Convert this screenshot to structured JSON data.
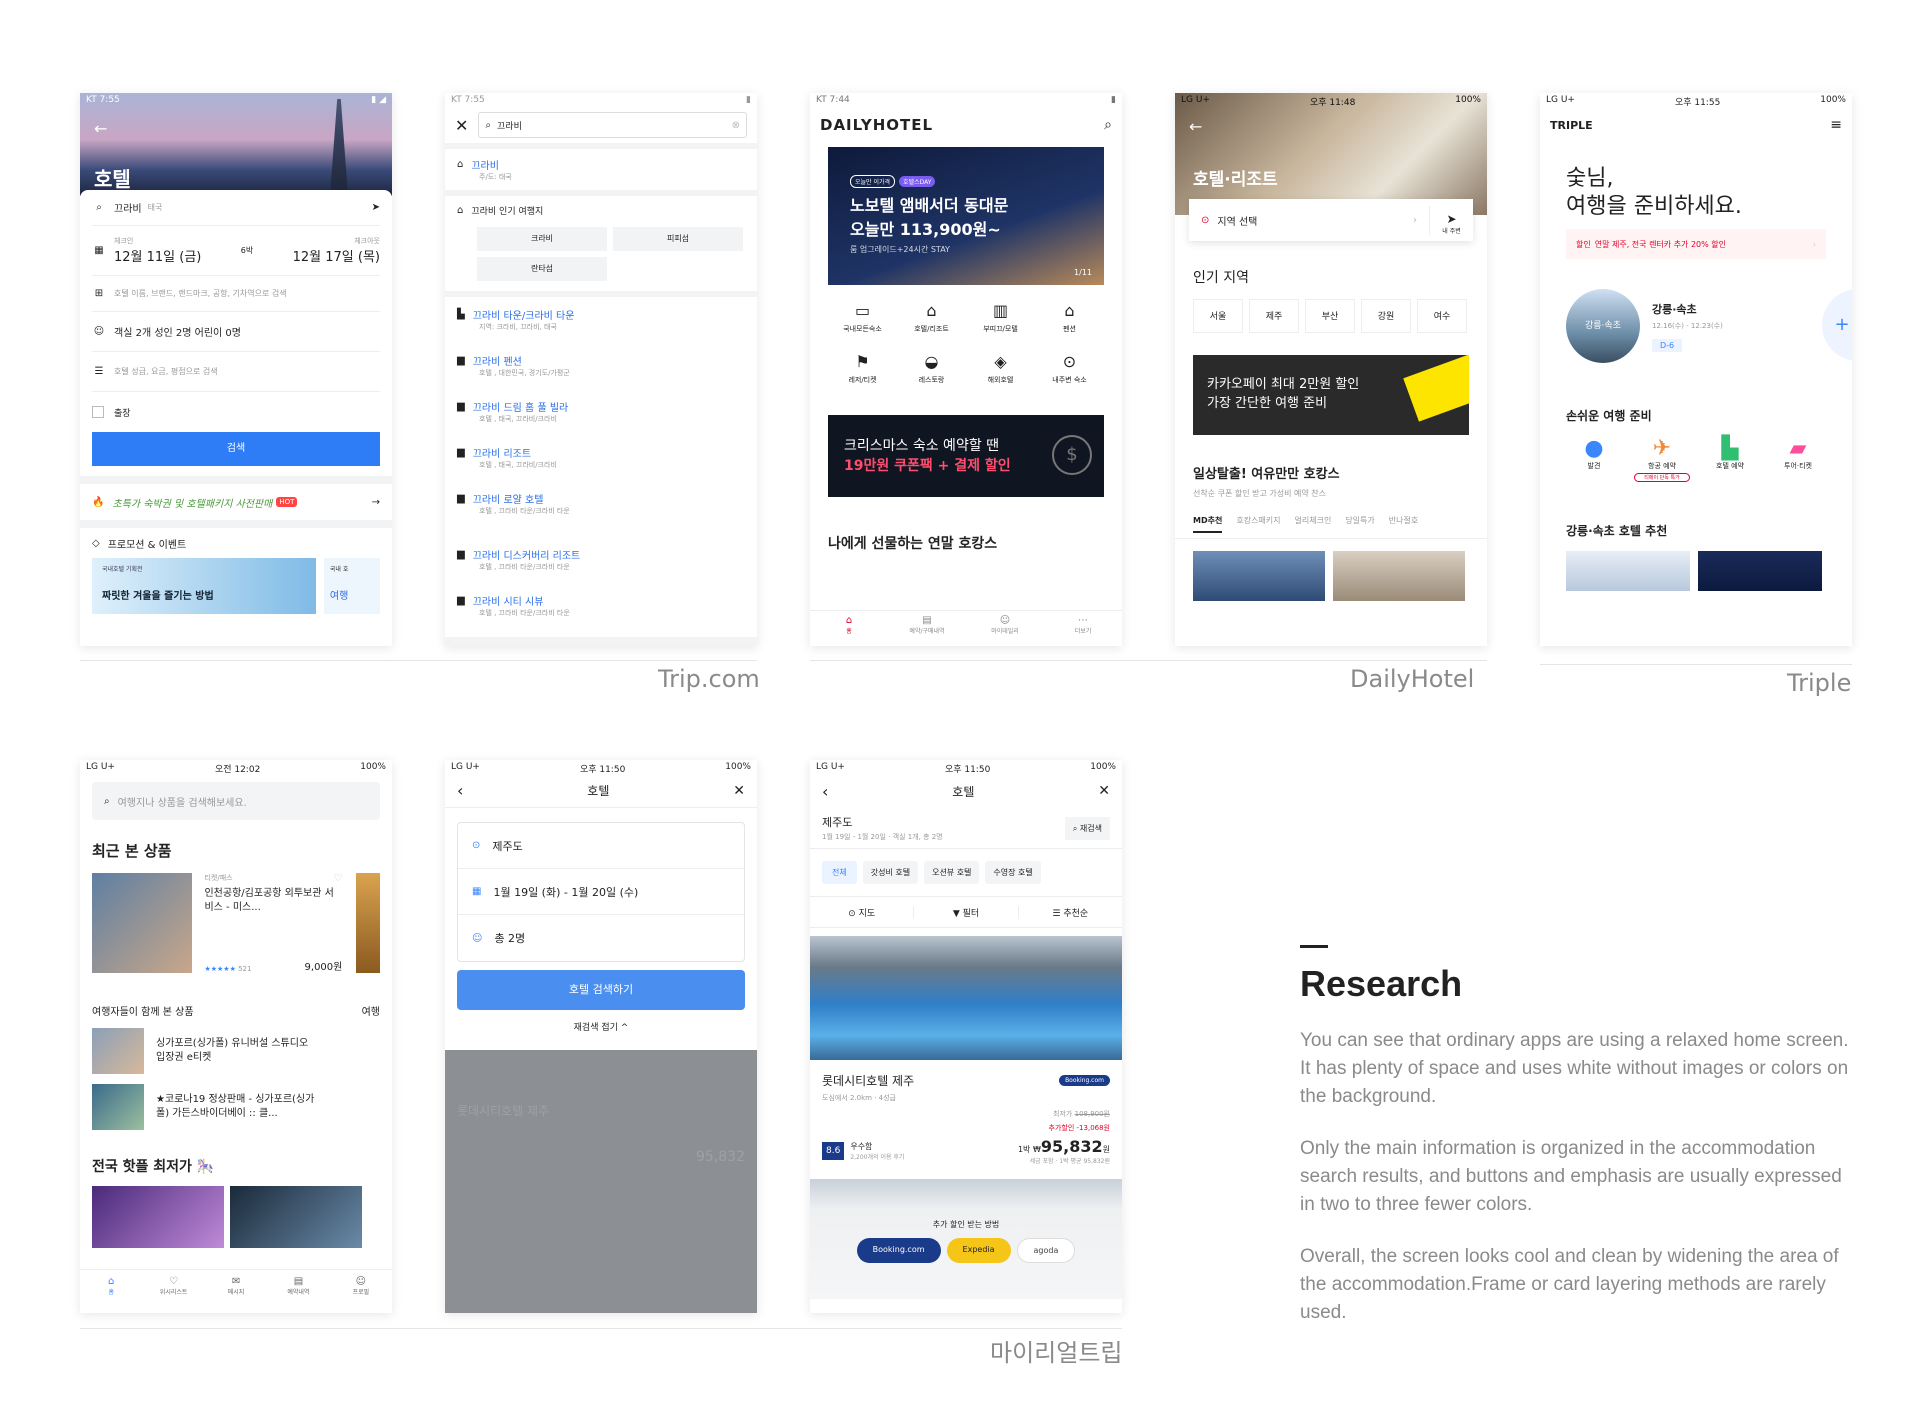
{
  "labels": {
    "trip": "Trip.com",
    "daily": "DailyHotel",
    "triple": "Triple",
    "myreal": "마이리얼트립"
  },
  "trip": {
    "status": "KT 7:55",
    "title": "호텔",
    "search_value": "끄라비",
    "search_tag": "태국",
    "checkin_label": "체크인",
    "checkout_label": "체크아웃",
    "checkin": "12월 11일 (금)",
    "nights": "6박",
    "checkout": "12월 17일 (목)",
    "keyword_placeholder": "호텔 이름, 브랜드, 랜드마크, 공항, 기차역으로 검색",
    "guests": "객실 2개  성인 2명  어린이 0명",
    "filter_placeholder": "호텔 성급, 요금, 평점으로 검색",
    "business": "출장",
    "search_btn": "검색",
    "promo": "초특가 숙박권 및 호텔패키지 사전판매",
    "hot": "HOT",
    "promo_section": "프로모션 & 이벤트",
    "banner_small": "국내호텔 기획전",
    "banner": "짜릿한 겨울을 즐기는 방법",
    "banner2_small": "국내 호",
    "banner2": "여행"
  },
  "trip2": {
    "status": "KT 7:55",
    "query": "끄라비",
    "top_title": "끄라비",
    "top_sub": "주/도: 태국",
    "popular": "끄라비 인기 여행지",
    "chips": [
      "크라비",
      "피피섬",
      "란타섬"
    ],
    "items": [
      {
        "t": "끄라비 타운/크라비 타운",
        "s": "지역: 크라비, 끄라비, 태국"
      },
      {
        "t": "끄라비 펜션",
        "s": "호텔 , 대한민국, 경기도/가평군"
      },
      {
        "t": "끄라비 드림 홈 풀 빌라",
        "s": "호텔 , 태국, 끄라비/크라비"
      },
      {
        "t": "끄라비 리조트",
        "s": "호텔 , 태국, 끄라비/크라비"
      },
      {
        "t": "끄라비 로얄 호텔",
        "s": "호텔 , 끄라비 타운/크라비 타운"
      },
      {
        "t": "끄라비 디스커버리 리조트",
        "s": "호텔 , 끄라비 타운/크라비 타운"
      },
      {
        "t": "끄라비 시티 시뷰",
        "s": "호텔 , 끄라비 타운/크라비 타운"
      }
    ]
  },
  "daily": {
    "status": "KT 7:44",
    "logo": "DAILYHOTEL",
    "tag1": "오늘만 이가격",
    "tag2": "호텔스DAY",
    "hero1": "노보텔 앰배서더 동대문",
    "hero2": "오늘만 113,900원~",
    "hero_sub": "룸 업그레이드+24시간 STAY",
    "pager": "1/11",
    "cats": [
      "국내모든숙소",
      "호텔/리조트",
      "부띠끄/모텔",
      "펜션",
      "레저/티켓",
      "레스토랑",
      "해외호텔",
      "내주변 숙소"
    ],
    "banner1": "크리스마스 숙소 예약할 땐",
    "banner2": "19만원 쿠폰팩 + 결제 할인",
    "section": "나에게 선물하는 연말 호캉스",
    "tabs": [
      "홈",
      "예약/구매내역",
      "마이데일리",
      "더보기"
    ]
  },
  "daily2": {
    "status": "LG U+",
    "time": "오후 11:48",
    "battery": "100%",
    "title": "호텔·리조트",
    "region": "지역 선택",
    "near": "내 주변",
    "popular": "인기 지역",
    "areas": [
      "서울",
      "제주",
      "부산",
      "강원",
      "여수"
    ],
    "kakao1": "카카오페이 최대 2만원 할인",
    "kakao2": "가장 간단한 여행 준비",
    "sec2": "일상탈출! 여유만만 호캉스",
    "sec2_sub": "선착순 쿠폰 할인 받고 가성비 예약 찬스",
    "tabs": [
      "MD추천",
      "호캉스패키지",
      "얼리체크인",
      "당일특가",
      "반나절호"
    ]
  },
  "triple": {
    "status": "LG U+",
    "time": "오후 11:55",
    "battery": "100%",
    "logo": "TRIPLE",
    "greet1": "숯님,",
    "greet2": "여행을 준비하세요.",
    "promo_tag": "할인",
    "promo": "연말 제주, 전국 렌터카 추가 20% 할인",
    "trip_city": "강릉·속초",
    "trip_title": "강릉·속초",
    "trip_dates": "12.16(수) - 12.23(수)",
    "dday": "D-6",
    "prep": "손쉬운 여행 준비",
    "preps": [
      "발견",
      "항공 예약",
      "호텔 예약",
      "투어·티켓"
    ],
    "prep_badge": "티메이 단독 특가",
    "rec": "강릉·속초 호텔 추천"
  },
  "mrt1": {
    "status": "LG U+",
    "time": "오전 12:02",
    "battery": "100%",
    "search_placeholder": "여행지나 상품을 검색해보세요.",
    "recent": "최근 본 상품",
    "card_cat": "티켓/패스",
    "card_title": "인천공항/김포공항 외투보관 서비스 - 미스...",
    "card_rating": "★★★★★",
    "card_count": "521",
    "card_price": "9,000원",
    "together": "여행자들이 함께 본 상품",
    "together_more": "여행",
    "list": [
      "싱가포르(싱가폴) 유니버설 스튜디오 입장권 e티켓",
      "★코로나19 정상판매 - 싱가포르(싱가폴) 가든스바이더베이 :: 클..."
    ],
    "hot": "전국 핫플 최저가 🎠",
    "tabs": [
      "홈",
      "위시리스트",
      "메시지",
      "예약내역",
      "프로필"
    ]
  },
  "mrt2": {
    "status": "LG U+",
    "time": "오후 11:50",
    "battery": "100%",
    "title": "호텔",
    "dest": "제주도",
    "dates": "1월 19일 (화) - 1월 20일 (수)",
    "guests": "총 2명",
    "btn": "호텔 검색하기",
    "collapse": "재검색 접기",
    "dim_title": "롯데시티호텔 제주",
    "dim_price": "95,832"
  },
  "mrt3": {
    "status": "LG U+",
    "time": "오후 11:50",
    "battery": "100%",
    "title": "호텔",
    "dest": "제주도",
    "sub": "1월 19일 - 1월 20일 · 객실 1개, 총 2명",
    "research": "재검색",
    "chips": [
      "전체",
      "갓성비 호텔",
      "오션뷰 호텔",
      "수영장 호텔"
    ],
    "tools": [
      "지도",
      "필터",
      "추천순"
    ],
    "hotel": "롯데시티호텔 제주",
    "hotel_sub": "도심에서 2.0km · 4성급",
    "provider": "Booking.com",
    "orig_label": "최저가",
    "orig": "108,900원",
    "discount": "추가할인 -13,068원",
    "price_prefix": "1박 ₩",
    "price": "95,832",
    "price_unit": "원",
    "price_sub": "세금 포함 · 1박 평균 95,832원",
    "score": "8.6",
    "score_label": "우수함",
    "reviews": "2,200개의 이용 후기",
    "partners_title": "추가 할인 받는 방법",
    "partners": [
      "Booking.com",
      "Expedia",
      "agoda"
    ]
  },
  "research": {
    "title": "Research",
    "p1": "You can see that ordinary apps are using a relaxed home screen. It has plenty of space and uses white without images or colors on the background.",
    "p2": "Only the main information is organized in the accommodation search results, and buttons and emphasis are usually expressed in two to three fewer colors.",
    "p3": "Overall, the screen looks cool and clean by widening the area of the accommodation.Frame or card layering methods are rarely used."
  }
}
